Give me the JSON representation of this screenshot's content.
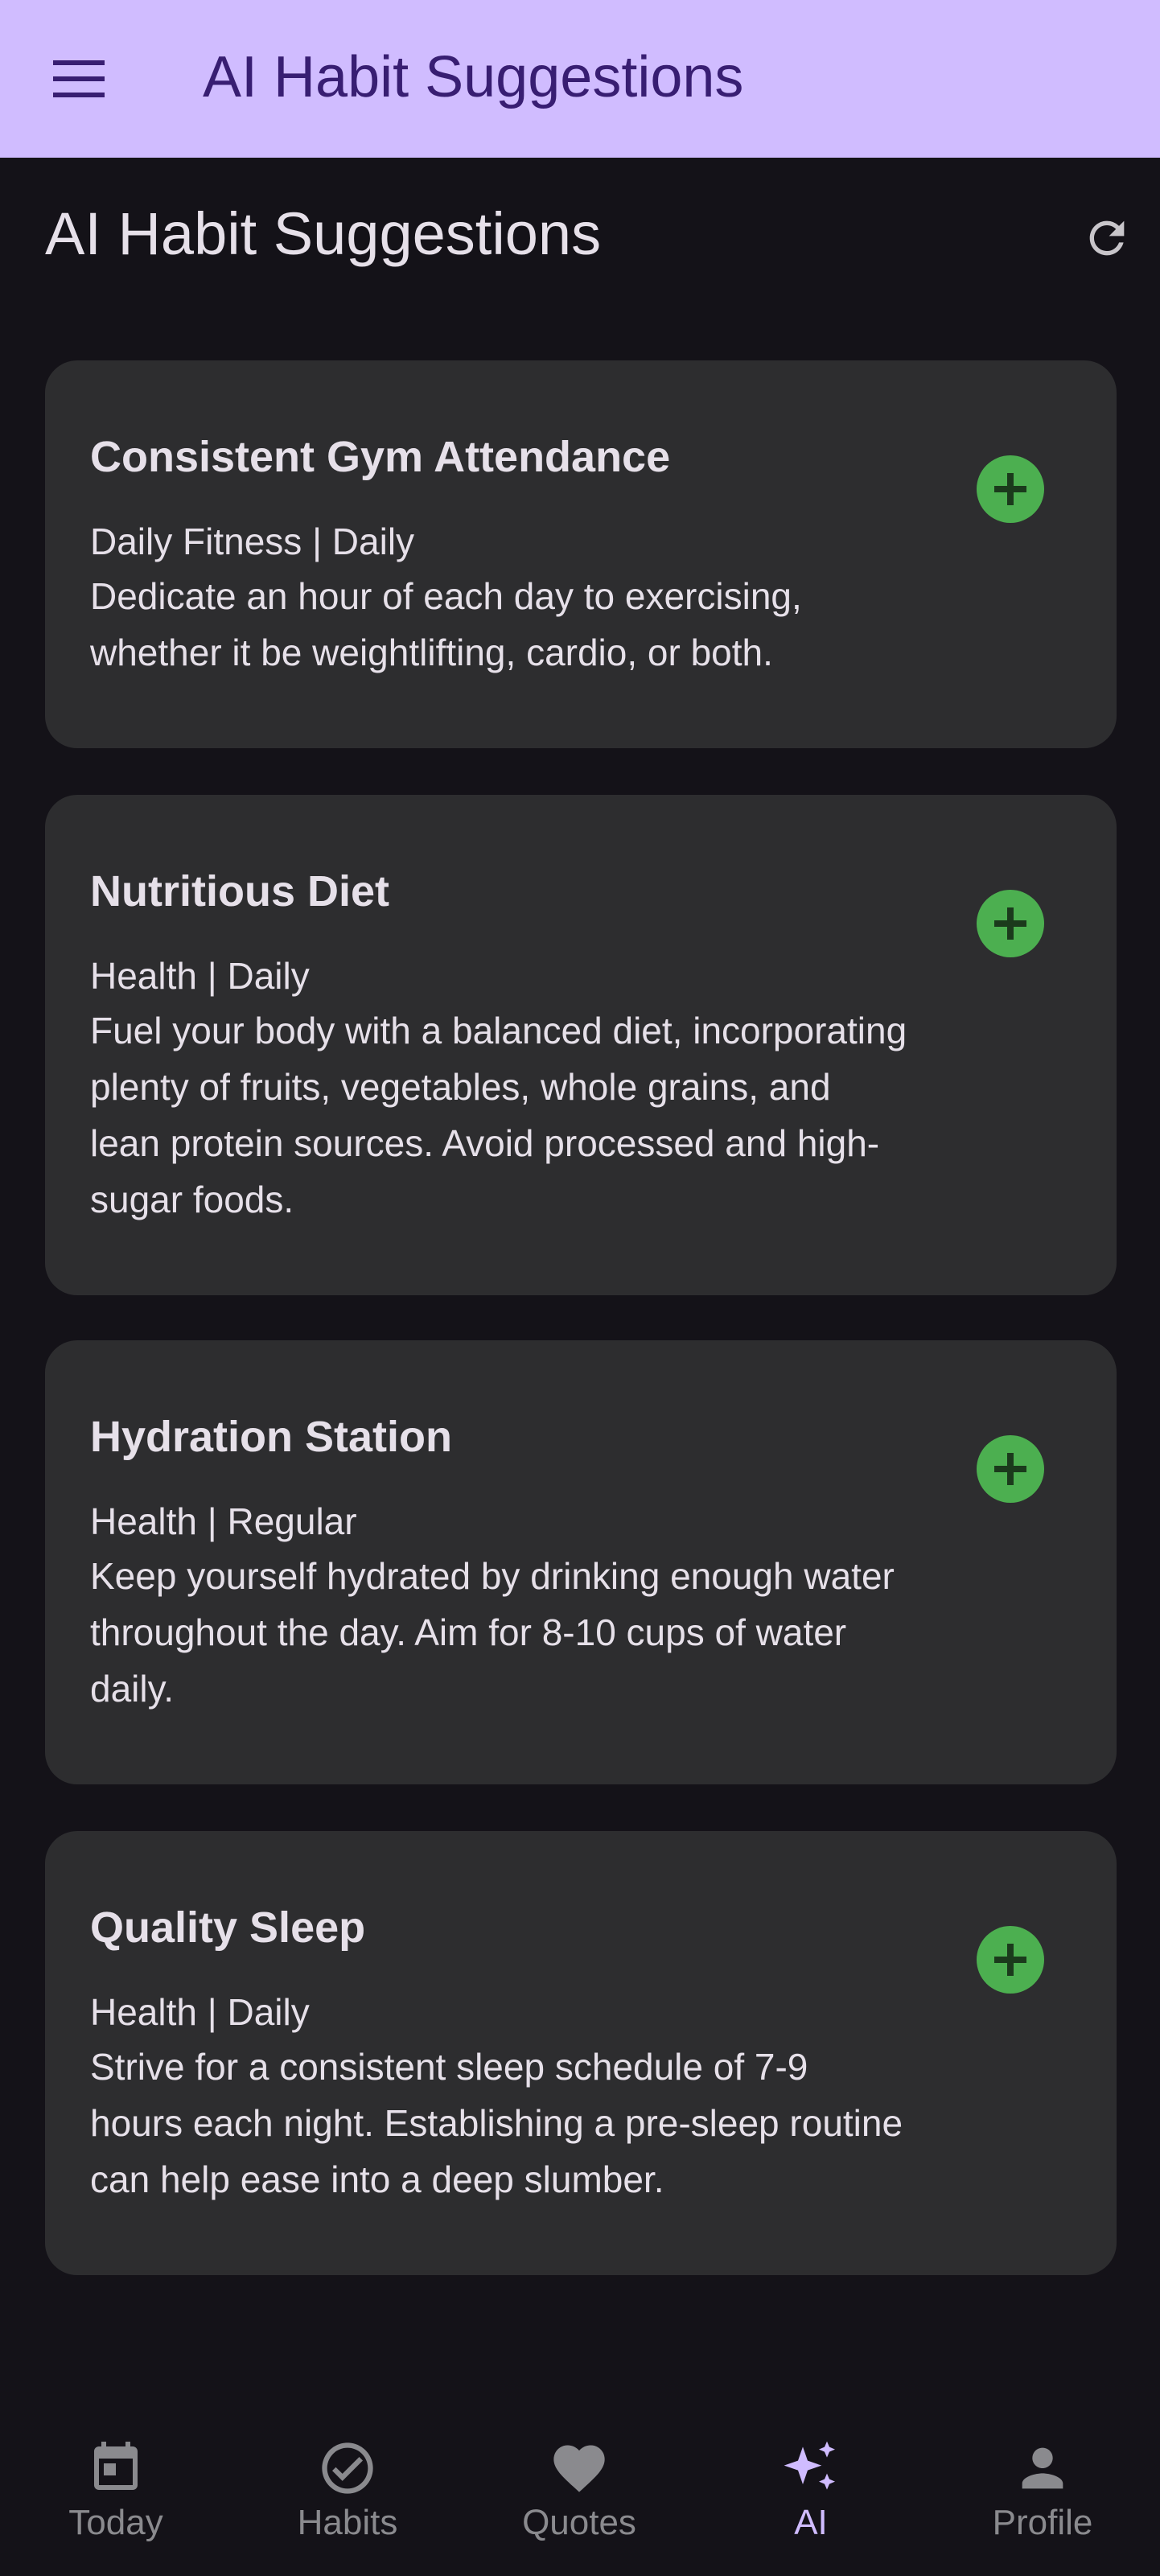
{
  "app_bar": {
    "title": "AI Habit Suggestions",
    "menu_icon": "menu-icon",
    "background": "#d0bcff",
    "title_color": "#381e72"
  },
  "page": {
    "title": "AI Habit Suggestions",
    "refresh_icon": "refresh-icon"
  },
  "suggestions": [
    {
      "title": "Consistent Gym Attendance",
      "meta": "Daily Fitness | Daily",
      "description": "Dedicate an hour of each day to exercising, whether it be weightlifting, cardio, or both.",
      "action_icon": "add-circle-icon"
    },
    {
      "title": "Nutritious Diet",
      "meta": "Health | Daily",
      "description": "Fuel your body with a balanced diet, incorporating plenty of fruits, vegetables, whole grains, and lean protein sources. Avoid processed and high-sugar foods.",
      "action_icon": "add-circle-icon"
    },
    {
      "title": "Hydration Station",
      "meta": "Health | Regular",
      "description": "Keep yourself hydrated by drinking enough water throughout the day. Aim for 8-10 cups of water daily.",
      "action_icon": "add-circle-icon"
    },
    {
      "title": "Quality Sleep",
      "meta": "Health | Daily",
      "description": "Strive for a consistent sleep schedule of 7-9 hours each night. Establishing a pre-sleep routine can help ease into a deep slumber.",
      "action_icon": "add-circle-icon"
    }
  ],
  "bottom_nav": {
    "items": [
      {
        "label": "Today",
        "icon": "calendar-icon",
        "active": false
      },
      {
        "label": "Habits",
        "icon": "check-circle-icon",
        "active": false
      },
      {
        "label": "Quotes",
        "icon": "heart-icon",
        "active": false
      },
      {
        "label": "AI",
        "icon": "sparkles-icon",
        "active": true
      },
      {
        "label": "Profile",
        "icon": "person-icon",
        "active": false
      }
    ]
  },
  "colors": {
    "background": "#141218",
    "card": "#2d2d2f",
    "accent": "#d0bcff",
    "add_button": "#4caf50",
    "inactive_nav": "#8a8a8e"
  }
}
